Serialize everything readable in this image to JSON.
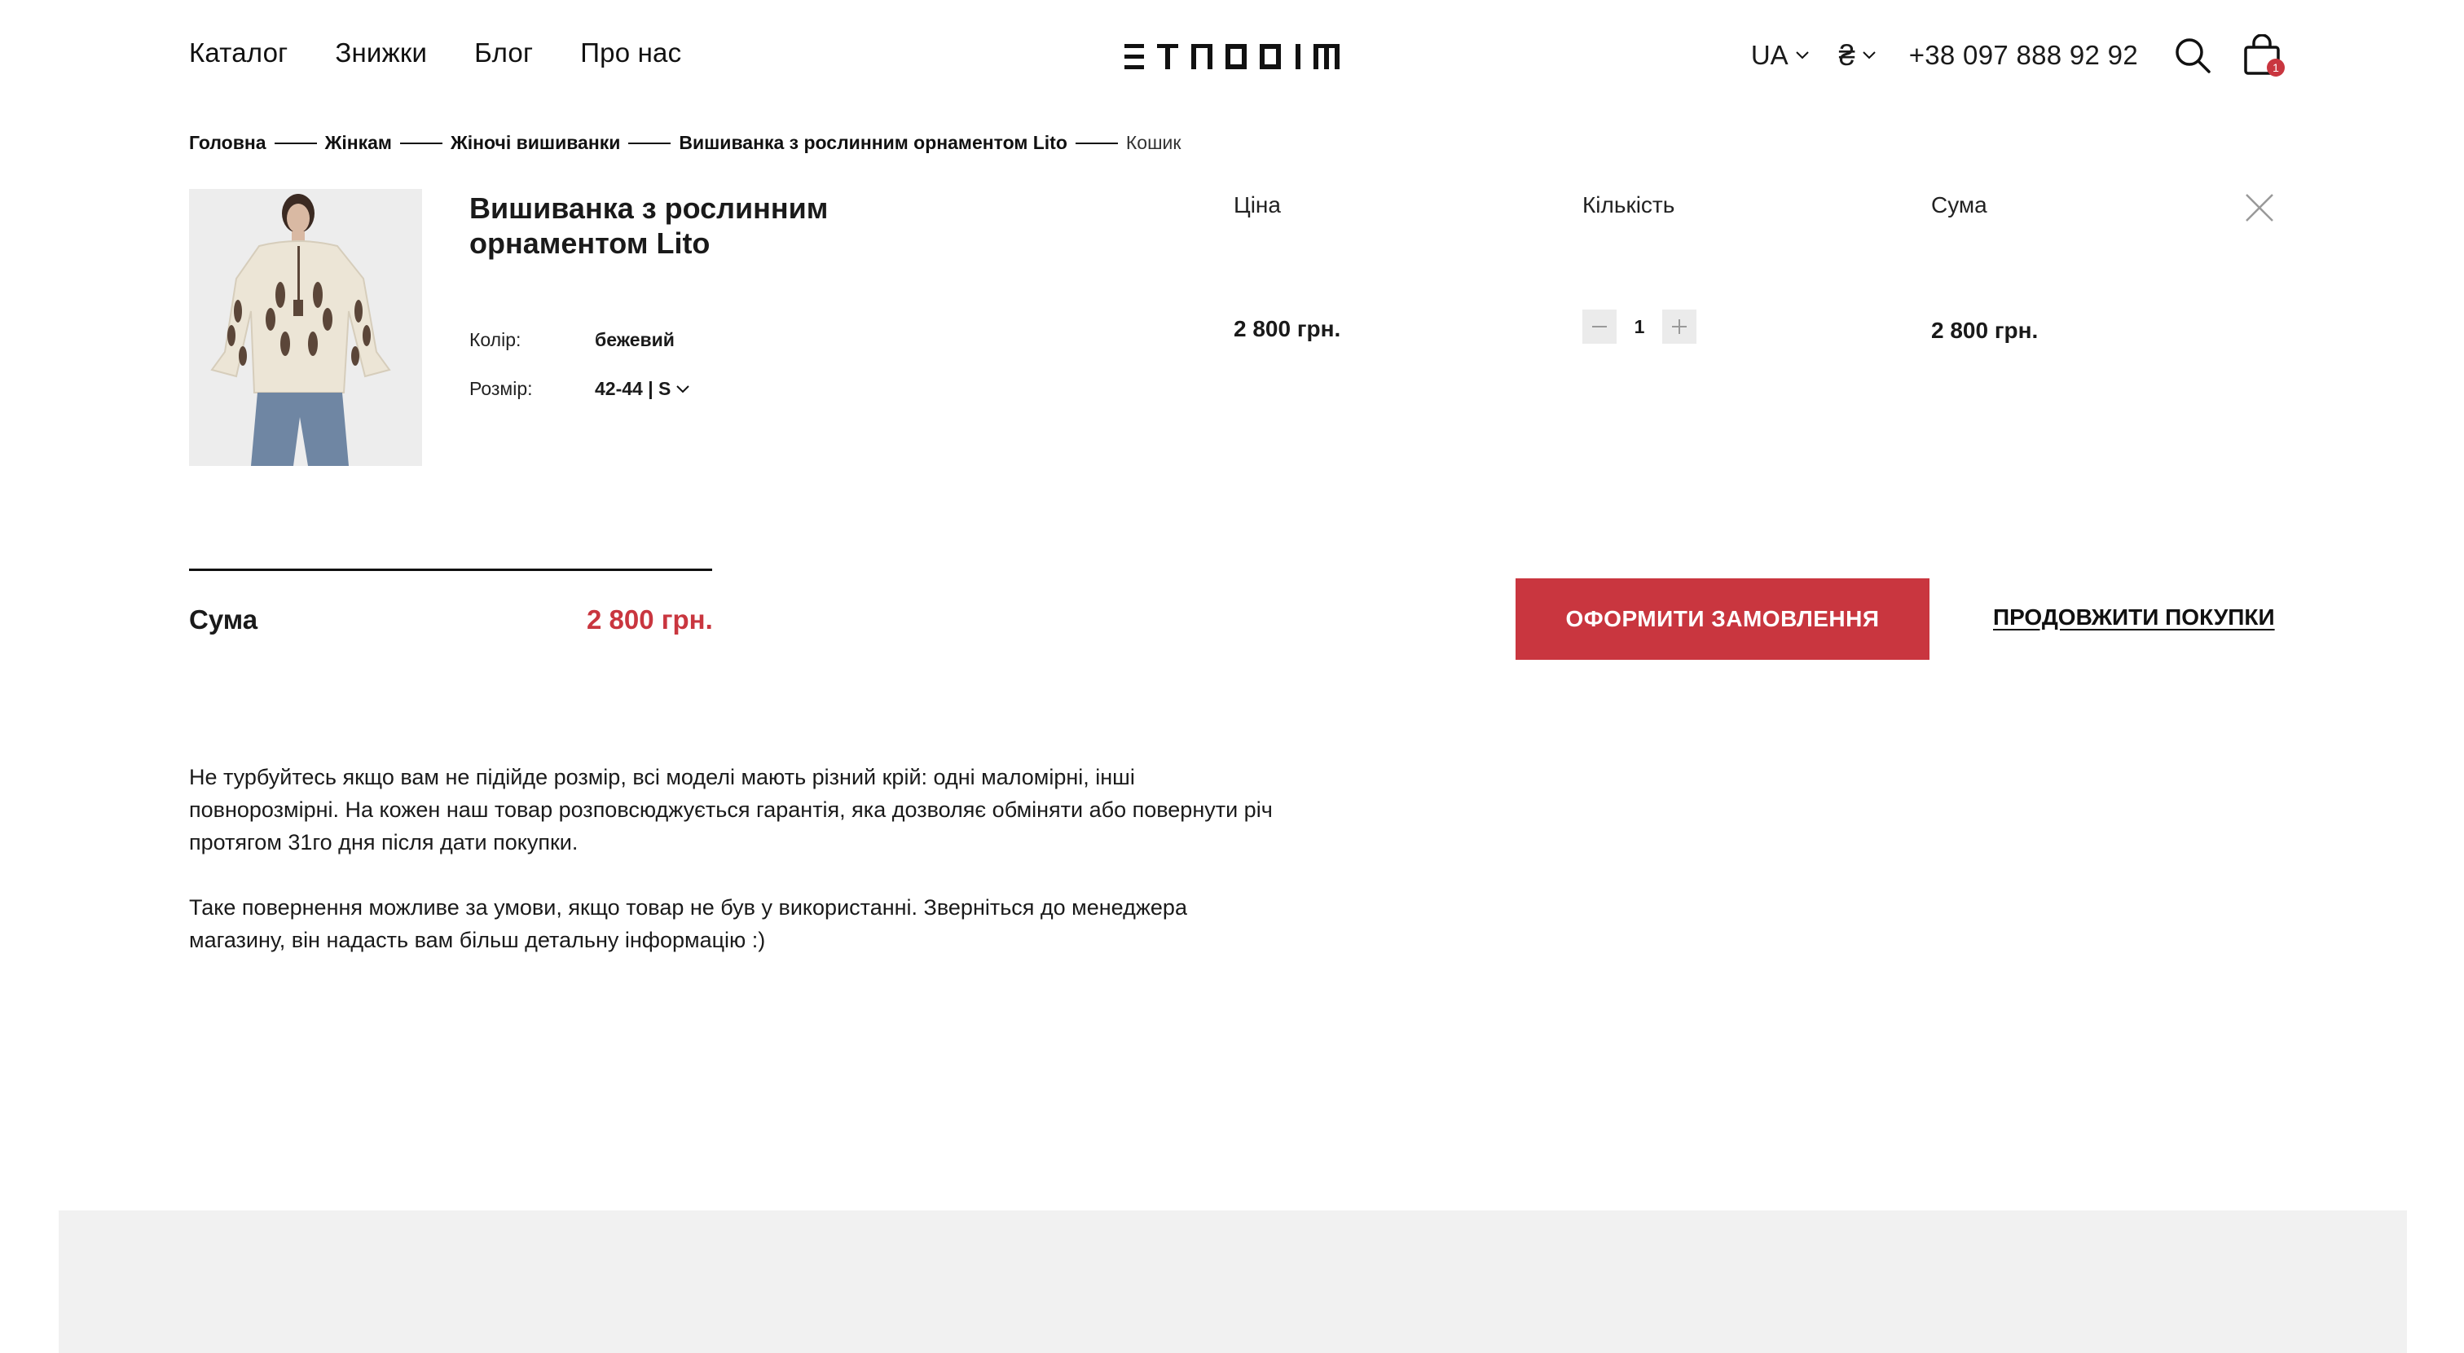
{
  "header": {
    "nav": [
      "Каталог",
      "Знижки",
      "Блог",
      "Про нас"
    ],
    "logo_text": "ETNODIM",
    "language": "UA",
    "currency_symbol": "₴",
    "phone": "+38 097 888 92 92",
    "cart_count": "1"
  },
  "breadcrumb": [
    "Головна",
    "Жінкам",
    "Жіночі вишиванки",
    "Вишиванка з рослинним орнаментом Lito",
    "Кошик"
  ],
  "cart": {
    "columns": {
      "price": "Ціна",
      "quantity": "Кількість",
      "sum": "Сума"
    },
    "item": {
      "title": "Вишиванка з рослинним орнаментом Lito",
      "color_label": "Колір:",
      "color_value": "бежевий",
      "size_label": "Розмір:",
      "size_value": "42-44 | S",
      "price": "2 800 грн.",
      "quantity": "1",
      "sum": "2 800 грн."
    }
  },
  "totals": {
    "label": "Сума",
    "value": "2 800 грн.",
    "checkout": "ОФОРМИТИ ЗАМОВЛЕННЯ",
    "continue": "ПРОДОВЖИТИ ПОКУПКИ"
  },
  "info": {
    "p1": "Не турбуйтесь якщо вам не підійде розмір, всі моделі мають різний крій: одні маломірні, інші повнорозмірні. На кожен наш товар розповсюджується гарантія, яка дозволяє обміняти або повернути річ протягом 31го дня після дати покупки.",
    "p2": "Таке повернення можливе за умови, якщо товар не був у використанні. Зверніться до менеджера магазину, він надасть вам більш детальну інформацію :)"
  },
  "colors": {
    "accent": "#c9363f",
    "footer_bg": "#f1f1f1"
  }
}
